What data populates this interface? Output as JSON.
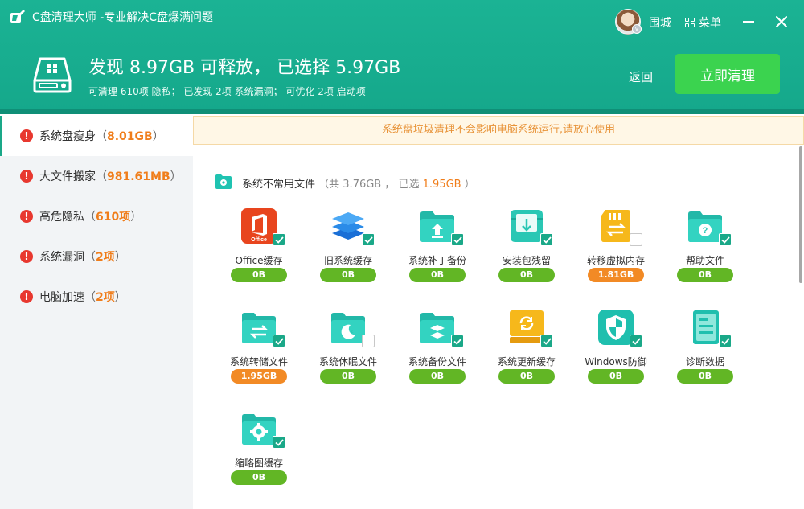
{
  "app": {
    "title": "C盘清理大师 -专业解决C盘爆满问题",
    "username": "围城",
    "menu_label": "菜单"
  },
  "header": {
    "headline": "发现 8.97GB 可释放， 已选择 5.97GB",
    "subline": "可清理 610项 隐私；  已发现 2项 系统漏洞；  可优化 2项 启动项",
    "back_label": "返回",
    "clean_label": "立即清理"
  },
  "sidebar": {
    "items": [
      {
        "label": "系统盘瘦身",
        "value": "8.01GB",
        "active": true
      },
      {
        "label": "大文件搬家",
        "value": "981.61MB",
        "active": false
      },
      {
        "label": "高危隐私",
        "value": "610项",
        "active": false
      },
      {
        "label": "系统漏洞",
        "value": "2项",
        "active": false
      },
      {
        "label": "电脑加速",
        "value": "2项",
        "active": false
      }
    ]
  },
  "notice": "系统盘垃圾清理不会影响电脑系统运行,请放心使用",
  "section": {
    "title": "系统不常用文件",
    "stat_prefix": "（共 3.76GB ， 已选",
    "selected": "1.95GB",
    "stat_suffix": "）"
  },
  "items": [
    {
      "name": "Office缓存",
      "size": "0B",
      "icon": "office-icon",
      "checked": true
    },
    {
      "name": "旧系统缓存",
      "size": "0B",
      "icon": "layers-icon",
      "checked": true
    },
    {
      "name": "系统补丁备份",
      "size": "0B",
      "icon": "folder-upload-icon",
      "checked": true
    },
    {
      "name": "安装包残留",
      "size": "0B",
      "icon": "package-download-icon",
      "checked": true
    },
    {
      "name": "转移虚拟内存",
      "size": "1.81GB",
      "icon": "memory-card-icon",
      "checked": false
    },
    {
      "name": "帮助文件",
      "size": "0B",
      "icon": "folder-help-icon",
      "checked": true
    },
    {
      "name": "系统转储文件",
      "size": "1.95GB",
      "icon": "folder-transfer-icon",
      "checked": true
    },
    {
      "name": "系统休眠文件",
      "size": "0B",
      "icon": "folder-sleep-icon",
      "checked": false
    },
    {
      "name": "系统备份文件",
      "size": "0B",
      "icon": "folder-layers-icon",
      "checked": true
    },
    {
      "name": "系统更新缓存",
      "size": "0B",
      "icon": "refresh-box-icon",
      "checked": true
    },
    {
      "name": "Windows防御",
      "size": "0B",
      "icon": "shield-icon",
      "checked": true
    },
    {
      "name": "诊断数据",
      "size": "0B",
      "icon": "document-icon",
      "checked": true
    },
    {
      "name": "缩略图缓存",
      "size": "0B",
      "icon": "folder-gear-icon",
      "checked": true
    }
  ]
}
